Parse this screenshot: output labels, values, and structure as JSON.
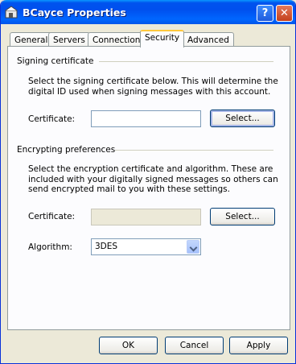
{
  "window": {
    "title": "BCayce Properties",
    "help_label": "?",
    "close_label": "✕"
  },
  "tabs": [
    {
      "label": "General",
      "active": false
    },
    {
      "label": "Servers",
      "active": false
    },
    {
      "label": "Connection",
      "active": false
    },
    {
      "label": "Security",
      "active": true
    },
    {
      "label": "Advanced",
      "active": false
    }
  ],
  "signing": {
    "group_title": "Signing certificate",
    "description": "Select the signing certificate below. This will determine the digital ID used when signing messages with this account.",
    "certificate_label": "Certificate:",
    "certificate_value": "",
    "select_button": "Select..."
  },
  "encrypting": {
    "group_title": "Encrypting preferences",
    "description": "Select the encryption certificate and algorithm. These are included with your digitally signed messages so others can send encrypted mail to you with these settings.",
    "certificate_label": "Certificate:",
    "certificate_value": "",
    "select_button": "Select...",
    "algorithm_label": "Algorithm:",
    "algorithm_value": "3DES"
  },
  "footer": {
    "ok": "OK",
    "cancel": "Cancel",
    "apply": "Apply"
  },
  "colors": {
    "titlebar": "#0054e3",
    "dialog_bg": "#ece9d8",
    "active_tab_accent": "#ffc83c"
  }
}
